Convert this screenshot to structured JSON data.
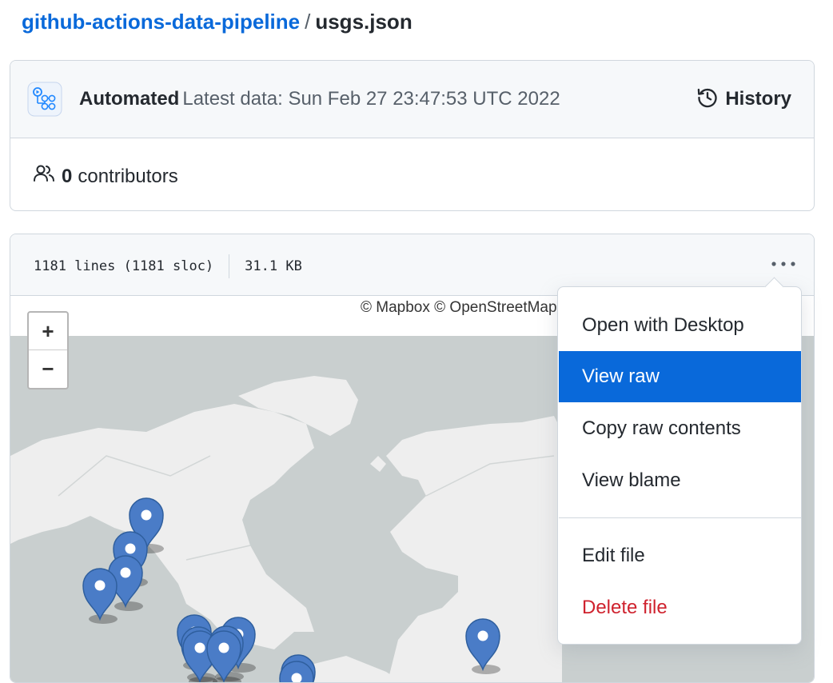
{
  "breadcrumb": {
    "repo": "github-actions-data-pipeline",
    "separator": "/",
    "file": "usgs.json"
  },
  "commit": {
    "avatar_icon": "github-actions-icon",
    "author": "Automated",
    "message": "Latest data: Sun Feb 27 23:47:53 UTC 2022",
    "history_label": "History",
    "history_icon": "history-clock-icon"
  },
  "contributors": {
    "icon": "people-icon",
    "count": "0",
    "label": "contributors"
  },
  "file": {
    "lines": "1181 lines (1181 sloc)",
    "size": "31.1 KB",
    "menu_icon": "kebab-horizontal-icon"
  },
  "map": {
    "attribution": "© Mapbox © OpenStreetMap",
    "zoom_in": "+",
    "zoom_out": "−",
    "marker_color": "#4a7cc7",
    "ocean_color": "#c9cfcf",
    "land_color": "#eeeeee"
  },
  "menu": {
    "open_desktop": "Open with Desktop",
    "view_raw": "View raw",
    "copy_raw": "Copy raw contents",
    "view_blame": "View blame",
    "edit_file": "Edit file",
    "delete_file": "Delete file",
    "active_color": "#0969da",
    "danger_color": "#cf222e"
  }
}
